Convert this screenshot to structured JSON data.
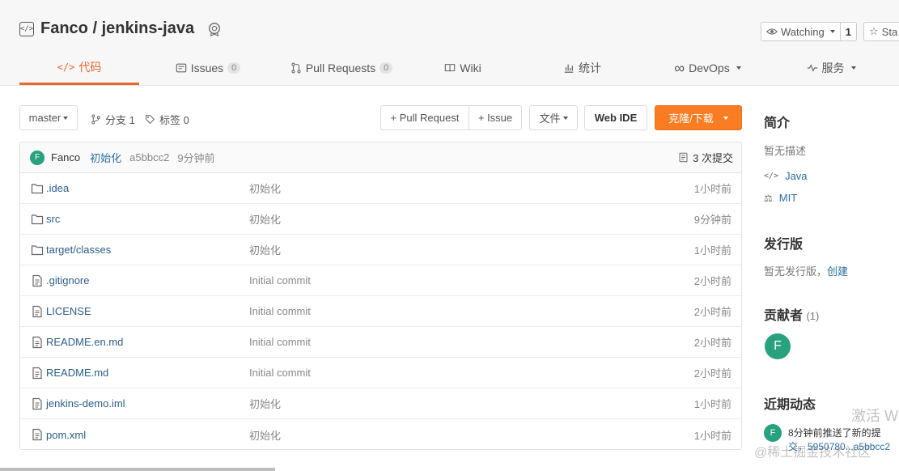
{
  "repo": {
    "title": "Fanco / jenkins-java"
  },
  "watch": {
    "label": "Watching",
    "count": "1"
  },
  "star": {
    "label": "Sta"
  },
  "tabs": [
    {
      "label": "代码",
      "count": ""
    },
    {
      "label": "Issues",
      "count": "0"
    },
    {
      "label": "Pull Requests",
      "count": "0"
    },
    {
      "label": "Wiki",
      "count": ""
    },
    {
      "label": "统计",
      "count": ""
    },
    {
      "label": "DevOps",
      "count": ""
    },
    {
      "label": "服务",
      "count": ""
    }
  ],
  "toolbar": {
    "branch": "master",
    "branches": "分支 1",
    "tags": "标签 0",
    "pull_request": "+ Pull Request",
    "issue": "+ Issue",
    "file": "文件",
    "web_ide": "Web IDE",
    "clone": "克隆/下载"
  },
  "commit": {
    "avatar": "F",
    "author": "Fanco",
    "message": "初始化",
    "sha": "a5bbcc2",
    "time": "9分钟前",
    "commits": "3 次提交"
  },
  "files": [
    {
      "type": "folder",
      "name": ".idea",
      "message": "初始化",
      "time": "1小时前"
    },
    {
      "type": "folder",
      "name": "src",
      "message": "初始化",
      "time": "9分钟前"
    },
    {
      "type": "folder",
      "name": "target/classes",
      "message": "初始化",
      "time": "1小时前"
    },
    {
      "type": "file",
      "name": ".gitignore",
      "message": "Initial commit",
      "time": "2小时前"
    },
    {
      "type": "file",
      "name": "LICENSE",
      "message": "Initial commit",
      "time": "2小时前"
    },
    {
      "type": "file",
      "name": "README.en.md",
      "message": "Initial commit",
      "time": "2小时前"
    },
    {
      "type": "file",
      "name": "README.md",
      "message": "Initial commit",
      "time": "2小时前"
    },
    {
      "type": "file",
      "name": "jenkins-demo.iml",
      "message": "初始化",
      "time": "1小时前"
    },
    {
      "type": "file",
      "name": "pom.xml",
      "message": "初始化",
      "time": "1小时前"
    }
  ],
  "sidebar": {
    "intro_title": "简介",
    "intro_text": "暂无描述",
    "language": "Java",
    "license": "MIT",
    "release_title": "发行版",
    "release_text": "暂无发行版，",
    "release_create": "创建",
    "contributors_title": "贡献者",
    "contributors_count": "(1)",
    "contributor_avatar": "F",
    "activity_title": "近期动态",
    "activity_text": "8分钟前推送了新的提",
    "activity_sub": "交，5950780...a5bbcc2"
  },
  "watermarks": {
    "activate": "激活 W",
    "site": "@稀土掘金技术社区"
  },
  "colors": {
    "accent": "#e9692c",
    "clone_button": "#fa7d24",
    "link": "#2970a1",
    "avatar": "#27a17e"
  }
}
